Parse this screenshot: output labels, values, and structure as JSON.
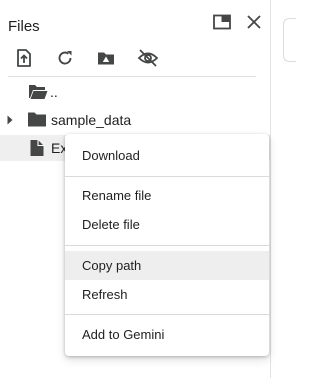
{
  "panel": {
    "title": "Files",
    "header_icons": [
      "open-in-window-icon",
      "close-icon"
    ],
    "toolbar_icons": [
      "upload-icon",
      "refresh-icon",
      "mount-drive-icon",
      "hide-files-icon"
    ]
  },
  "tree": {
    "parent": {
      "label": "..",
      "icon": "folder-open-icon"
    },
    "items": [
      {
        "label": "sample_data",
        "icon": "folder-icon",
        "expandable": true
      },
      {
        "label": "Ex",
        "icon": "file-icon",
        "expandable": false
      }
    ]
  },
  "context_menu": {
    "groups": [
      [
        {
          "label": "Download"
        }
      ],
      [
        {
          "label": "Rename file"
        },
        {
          "label": "Delete file"
        }
      ],
      [
        {
          "label": "Copy path",
          "hovered": true
        },
        {
          "label": "Refresh"
        }
      ],
      [
        {
          "label": "Add to Gemini"
        }
      ]
    ]
  },
  "colors": {
    "icon": "#444746",
    "text": "#1f1f1f",
    "hover": "#eeeeee",
    "divider": "#e0e0e0"
  }
}
